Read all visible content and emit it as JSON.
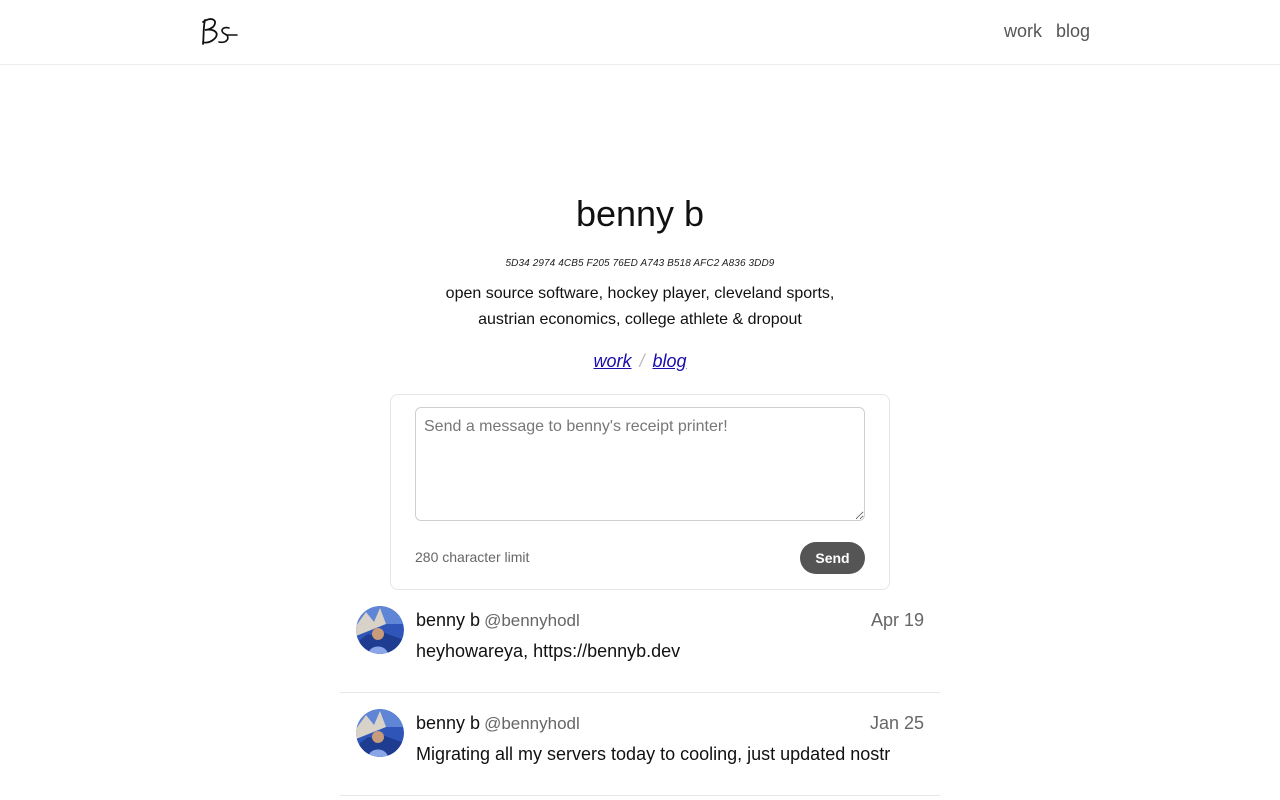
{
  "header": {
    "logo_text": "Bs",
    "nav": [
      {
        "label": "work"
      },
      {
        "label": "blog"
      }
    ]
  },
  "profile": {
    "name": "benny b",
    "fingerprint": "5D34 2974 4CB5 F205 76ED A743 B518 AFC2 A836 3DD9",
    "bio_line1": "open source software, hockey player, cleveland sports,",
    "bio_line2": "austrian economics, college athlete & dropout",
    "links": [
      {
        "label": "work"
      },
      {
        "label": "blog"
      }
    ],
    "link_separator": "/"
  },
  "composer": {
    "placeholder": "Send a message to benny's receipt printer!",
    "value": "",
    "limit_text": "280 character limit",
    "send_label": "Send"
  },
  "posts": [
    {
      "author": "benny b",
      "handle": "@bennyhodl",
      "date": "Apr 19",
      "body": "heyhowareya, https://bennyb.dev"
    },
    {
      "author": "benny b",
      "handle": "@bennyhodl",
      "date": "Jan 25",
      "body": "Migrating all my servers today to cooling, just updated nostr"
    }
  ],
  "colors": {
    "link": "#1a0dab",
    "send_button": "#555555",
    "border": "#e6e6e6"
  }
}
